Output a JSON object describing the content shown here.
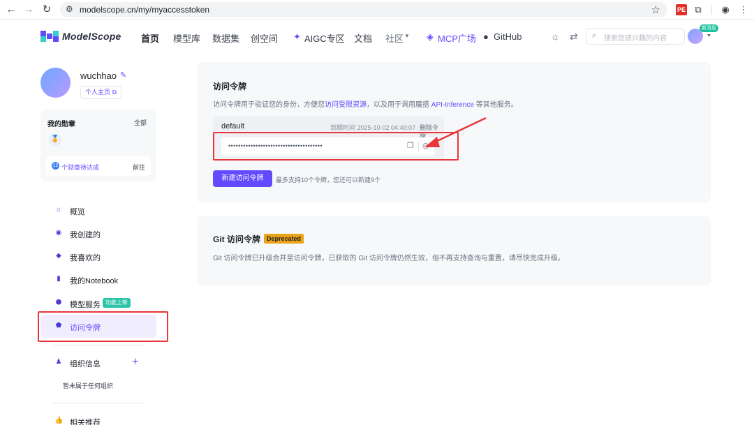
{
  "browser": {
    "url": "modelscope.cn/my/myaccesstoken",
    "ext_label": "PE"
  },
  "header": {
    "logo_text": "ModelScope",
    "nav": [
      "首页",
      "模型库",
      "数据集",
      "创空间",
      "AIGC专区",
      "文档",
      "社区",
      "MCP广场",
      "GitHub"
    ],
    "search_placeholder": "搜索您感兴趣的内容",
    "message_badge": "新消息"
  },
  "profile": {
    "username": "wuchhao",
    "homepage_label": "个人主页"
  },
  "badges": {
    "title": "我的勋章",
    "all_label": "全部",
    "pending_count": "12",
    "pending_label": "个勋章待达成",
    "goto_label": "前往"
  },
  "sidebar": {
    "items": [
      {
        "label": "概览"
      },
      {
        "label": "我创建的"
      },
      {
        "label": "我喜欢的"
      },
      {
        "label": "我的Notebook"
      },
      {
        "label": "模型服务"
      },
      {
        "label": "访问令牌"
      },
      {
        "label": "组织信息"
      },
      {
        "label": "相关推荐"
      }
    ],
    "new_tag": "功能上新",
    "no_org": "暂未属于任何组织"
  },
  "access_token": {
    "title": "访问令牌",
    "desc_prefix": "访问令牌用于验证您的身份，方便您",
    "desc_link1": "访问受限资源",
    "desc_mid": "，以及用于调用魔搭 ",
    "desc_link2": "API-Inference",
    "desc_suffix": " 等其他服务。",
    "token_name": "default",
    "expire": "到期时间 2025-10-02 04:49:07",
    "delete_label": "删除令牌",
    "masked_value": "••••••••••••••••••••••••••••••••••••••",
    "new_button": "新建访问令牌",
    "limit_tip": "最多支持10个令牌，您还可以新建9个"
  },
  "git_token": {
    "title": "Git 访问令牌",
    "tag": "Deprecated",
    "desc": "Git 访问令牌已升级合并至访问令牌，已获取的 Git 访问令牌仍然生效，但不再支持查询与重置，请尽快完成升级。"
  },
  "colors": {
    "accent": "#624aff",
    "highlight": "#e8363c",
    "deprecated": "#e8a317"
  }
}
